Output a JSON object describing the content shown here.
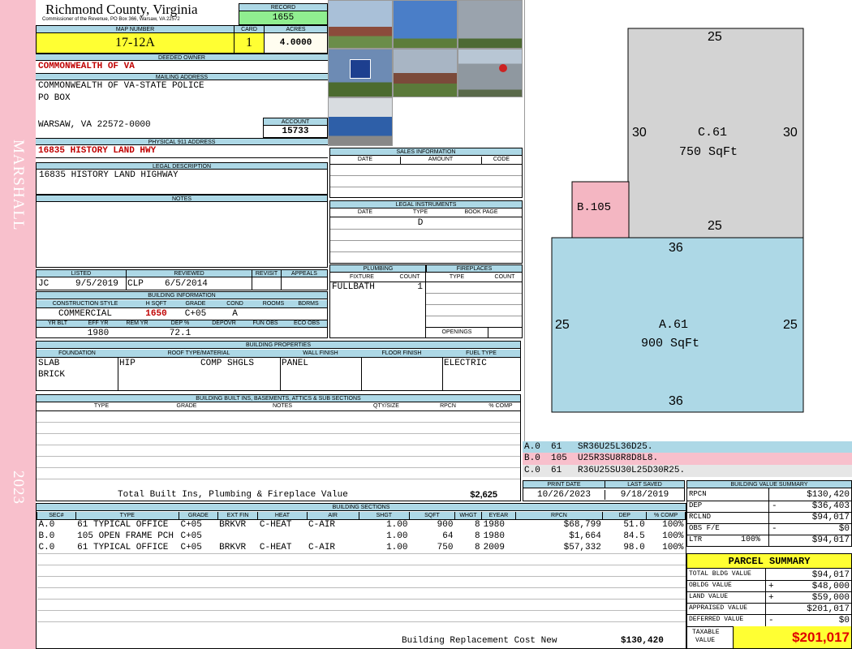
{
  "header": {
    "county": "Richmond County, Virginia",
    "commissioner": "Commissioner of the Revenue, PO Box 366, Warsaw, VA 22572",
    "record_label": "RECORD",
    "record": "1655",
    "map_label": "MAP NUMBER",
    "map": "17-12A",
    "card_label": "CARD",
    "card": "1",
    "acres_label": "ACRES",
    "acres": "4.0000"
  },
  "side": {
    "district": "MARSHALL",
    "year": "2023"
  },
  "owner": {
    "deeded_label": "DEEDED OWNER",
    "deeded": "COMMONWEALTH OF VA",
    "mailing_label": "MAILING ADDRESS",
    "line1": "COMMONWEALTH OF VA-STATE POLICE",
    "line2": "PO BOX",
    "line3": "WARSAW, VA 22572-0000",
    "account_label": "ACCOUNT",
    "account": "15733",
    "physical_label": "PHYSICAL 911 ADDRESS",
    "physical": "16835 HISTORY LAND HWY",
    "legal_label": "LEGAL DESCRIPTION",
    "legal": "16835 HISTORY LAND HIGHWAY",
    "notes_label": "NOTES"
  },
  "listing": {
    "listed_label": "LISTED",
    "reviewed_label": "REVIEWED",
    "revisit_label": "REVISIT",
    "appeals_label": "APPEALS",
    "listed_by": "JC",
    "listed_date": "9/5/2019",
    "reviewed_by": "CLP",
    "reviewed_date": "6/5/2014"
  },
  "building_info": {
    "label": "BUILDING INFORMATION",
    "h": [
      "CONSTRUCTION STYLE",
      "H SQFT",
      "GRADE",
      "COND",
      "ROOMS",
      "BDRMS"
    ],
    "style": "COMMERCIAL",
    "hsqft": "1650",
    "grade": "C+05",
    "cond": "A",
    "h2": [
      "YR BLT",
      "EFF YR",
      "REM YR",
      "DEP %",
      "DEPOVR",
      "FUN OBS",
      "ECO OBS"
    ],
    "eff_yr": "1980",
    "dep": "72.1"
  },
  "sales": {
    "label": "SALES INFORMATION",
    "h": [
      "DATE",
      "AMOUNT",
      "CODE"
    ]
  },
  "legal_inst": {
    "label": "LEGAL INSTRUMENTS",
    "h": [
      "DATE",
      "TYPE",
      "BOOK PAGE"
    ],
    "type": "D"
  },
  "plumbing": {
    "label": "PLUMBING",
    "h": [
      "FIXTURE",
      "COUNT"
    ],
    "fixture": "FULLBATH",
    "count": "1"
  },
  "fireplaces": {
    "label": "FIREPLACES",
    "h": [
      "TYPE",
      "COUNT"
    ],
    "openings": "OPENINGS"
  },
  "properties": {
    "label": "BUILDING PROPERTIES",
    "h": [
      "FOUNDATION",
      "ROOF TYPE/MATERIAL",
      "WALL FINISH",
      "FLOOR FINISH",
      "FUEL TYPE"
    ],
    "foundation1": "SLAB",
    "foundation2": "BRICK",
    "roof_type": "HIP",
    "roof_mat": "COMP SHGLS",
    "wall": "PANEL",
    "fuel": "ELECTRIC"
  },
  "builtins": {
    "label": "BUILDING BUILT INS, BASEMENTS, ATTICS & SUB SECTIONS",
    "h": [
      "TYPE",
      "GRADE",
      "NOTES",
      "QTY/SIZE",
      "RPCN",
      "% COMP"
    ],
    "total_label": "Total Built Ins, Plumbing & Fireplace Value",
    "total": "$2,625"
  },
  "sections": {
    "label": "BUILDING SECTIONS",
    "h": [
      "SEC#",
      "TYPE",
      "GRADE",
      "EXT FIN",
      "HEAT",
      "AIR",
      "SHGT",
      "SQFT",
      "WHGT",
      "EYEAR",
      "RPCN",
      "DEP",
      "% COMP"
    ],
    "rows": [
      [
        "A.0",
        "61 TYPICAL OFFICE",
        "C+05",
        "BRKVR",
        "C-HEAT",
        "C-AIR",
        "1.00",
        "900",
        "8",
        "1980",
        "$68,799",
        "51.0",
        "100%"
      ],
      [
        "B.0",
        "105 OPEN FRAME PCH",
        "C+05",
        "",
        "",
        "",
        "1.00",
        "64",
        "8",
        "1980",
        "$1,664",
        "84.5",
        "100%"
      ],
      [
        "C.0",
        "61 TYPICAL OFFICE",
        "C+05",
        "BRKVR",
        "C-HEAT",
        "C-AIR",
        "1.00",
        "750",
        "8",
        "2009",
        "$57,332",
        "98.0",
        "100%"
      ]
    ],
    "brcn_label": "Building Replacement Cost New",
    "brcn": "$130,420"
  },
  "sketch": {
    "c_label": "C.61",
    "c_area": "750 SqFt",
    "a_label": "A.61",
    "a_area": "900 SqFt",
    "b_label": "B.105",
    "dims": {
      "c_top": "25",
      "c_left": "30",
      "c_right": "30",
      "c_bottom": "25",
      "a_top": "36",
      "a_left": "25",
      "a_right": "25",
      "a_bottom": "36"
    },
    "colors": {
      "c": "#d3d3d3",
      "a": "#add8e6",
      "b": "#f4b6c2"
    }
  },
  "legend": [
    {
      "sec": "A.0",
      "code": "61",
      "path": "SR36U25L36D25."
    },
    {
      "sec": "B.0",
      "code": "105",
      "path": "U25R3SU8R8D8L8."
    },
    {
      "sec": "C.0",
      "code": "61",
      "path": "R36U25SU30L25D30R25."
    }
  ],
  "dates": {
    "print_label": "PRINT DATE",
    "print": "10/26/2023",
    "saved_label": "LAST SAVED",
    "saved": "9/18/2019"
  },
  "bvs": {
    "label": "BUILDING VALUE SUMMARY",
    "rpcn_l": "RPCN",
    "rpcn": "$130,420",
    "dep_l": "DEP",
    "dep_sign": "-",
    "dep": "$36,403",
    "rclnd_l": "RCLND",
    "rclnd": "$94,017",
    "obs_l": "OBS F/E",
    "obs_sign": "-",
    "obs": "$0",
    "ltr_l": "LTR",
    "ltr_pct": "100%",
    "ltr": "$94,017"
  },
  "parcel": {
    "label": "PARCEL SUMMARY",
    "tbv_l": "TOTAL BLDG VALUE",
    "tbv": "$94,017",
    "obldg_l": "OBLDG VALUE",
    "obldg_sign": "+",
    "obldg": "$48,000",
    "land_l": "LAND VALUE",
    "land_sign": "+",
    "land": "$59,000",
    "appr_l": "APPRAISED VALUE",
    "appr": "$201,017",
    "def_l": "DEFERRED VALUE",
    "def_sign": "-",
    "def": "$0",
    "tax_l1": "TAXABLE",
    "tax_l2": "VALUE",
    "tax": "$201,017"
  }
}
